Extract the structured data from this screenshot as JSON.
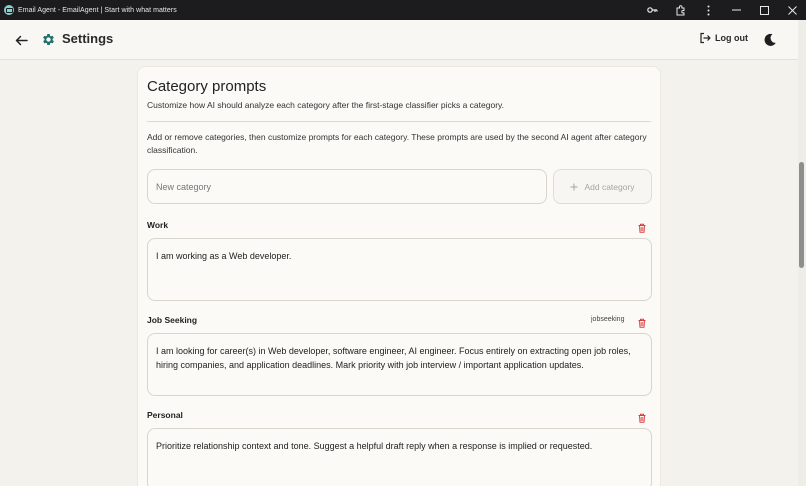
{
  "window": {
    "title": "Email Agent - EmailAgent | Start with what matters"
  },
  "header": {
    "title": "Settings",
    "logout_label": "Log out"
  },
  "card": {
    "title": "Category prompts",
    "subtitle": "Customize how AI should analyze each category after the first-stage classifier picks a category.",
    "description": "Add or remove categories, then customize prompts for each category. These prompts are used by the second AI agent after category classification.",
    "new_category_placeholder": "New category",
    "add_category_label": "Add category"
  },
  "categories": [
    {
      "name": "Work",
      "key": "",
      "prompt": "I am working as a Web developer."
    },
    {
      "name": "Job Seeking",
      "key": "jobseeking",
      "prompt": "I am looking for career(s) in Web developer, software engineer, AI engineer. Focus entirely on extracting open job roles, hiring companies, and application deadlines. Mark priority with job interview / important application updates."
    },
    {
      "name": "Personal",
      "key": "",
      "prompt": "Prioritize relationship context and tone. Suggest a helpful draft reply when a response is implied or requested."
    }
  ],
  "colors": {
    "accent_teal": "#1f6f6b",
    "danger_red": "#d94141",
    "background": "#f4f2ec"
  },
  "icons": {
    "back": "arrow-left-icon",
    "settings": "gear-icon",
    "logout": "logout-icon",
    "theme": "moon-icon",
    "delete": "trash-icon",
    "add": "plus-icon"
  }
}
